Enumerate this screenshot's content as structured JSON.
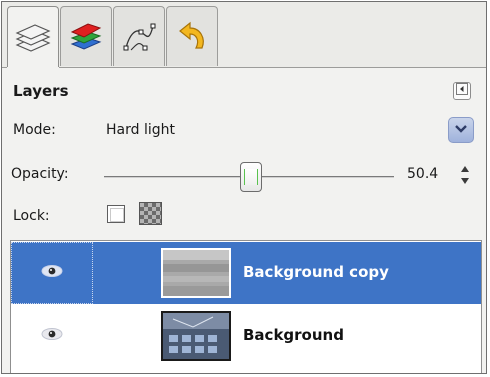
{
  "tabs": [
    {
      "name": "layers-tab",
      "icon": "layers-stack-icon",
      "active": true
    },
    {
      "name": "channels-tab",
      "icon": "channels-icon",
      "active": false
    },
    {
      "name": "paths-tab",
      "icon": "paths-icon",
      "active": false
    },
    {
      "name": "undo-history-tab",
      "icon": "undo-history-icon",
      "active": false
    }
  ],
  "panel": {
    "title": "Layers",
    "menu_icon": "tab-menu-icon"
  },
  "mode": {
    "label": "Mode:",
    "value": "Hard light",
    "dropdown_icon": "chevron-down-icon"
  },
  "opacity": {
    "label": "Opacity:",
    "value": "50.4",
    "level": 0.504
  },
  "lock": {
    "label": "Lock:",
    "pixels_icon": "lock-pixels-checkbox",
    "alpha_icon": "lock-alpha-checkbox"
  },
  "layers": [
    {
      "name": "Background copy",
      "visible": true,
      "selected": true,
      "eye_icon": "eye-icon"
    },
    {
      "name": "Background",
      "visible": true,
      "selected": false,
      "eye_icon": "eye-icon"
    }
  ],
  "colors": {
    "selection": "#3e74c6",
    "accent_dropdown": "#9fb2dc",
    "slider_handle": "#5ac24f"
  }
}
